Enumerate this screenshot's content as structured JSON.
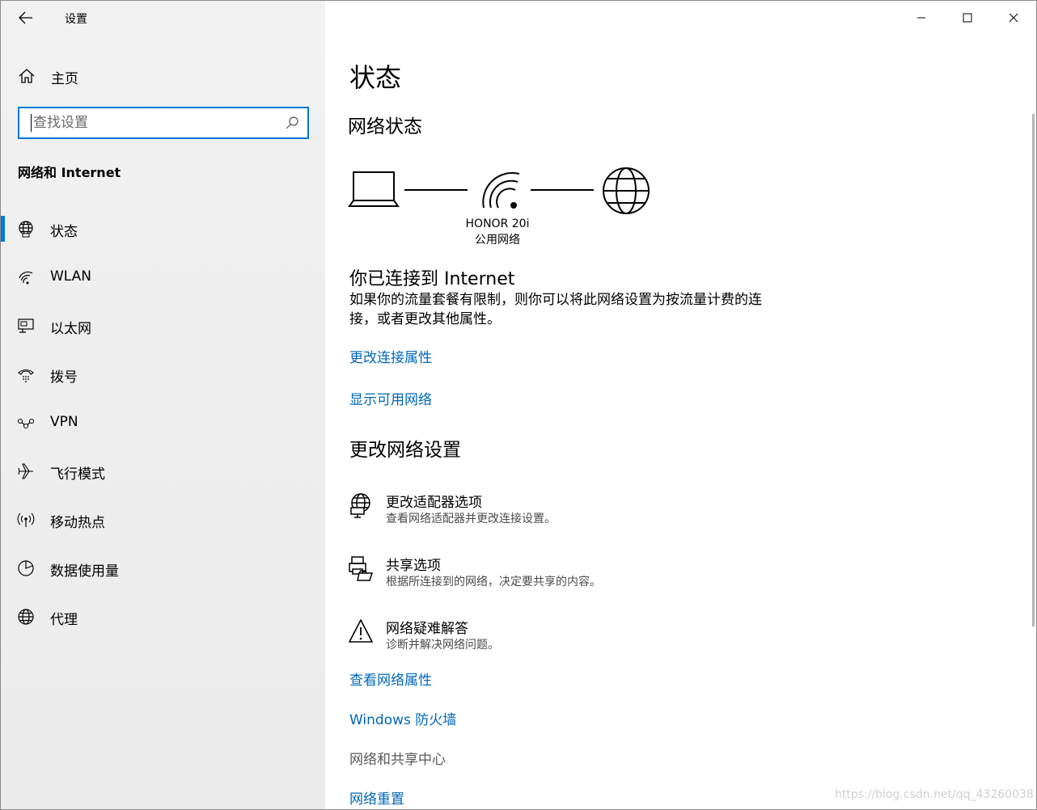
{
  "app": {
    "title": "设置"
  },
  "sidebar": {
    "home_label": "主页",
    "search_placeholder": "查找设置",
    "section_label": "网络和 Internet",
    "items": [
      {
        "label": "状态",
        "icon": "globe-status-icon",
        "active": true
      },
      {
        "label": "WLAN",
        "icon": "wifi-icon"
      },
      {
        "label": "以太网",
        "icon": "ethernet-icon"
      },
      {
        "label": "拨号",
        "icon": "dialup-icon"
      },
      {
        "label": "VPN",
        "icon": "vpn-icon"
      },
      {
        "label": "飞行模式",
        "icon": "airplane-icon"
      },
      {
        "label": "移动热点",
        "icon": "hotspot-icon"
      },
      {
        "label": "数据使用量",
        "icon": "data-usage-icon"
      },
      {
        "label": "代理",
        "icon": "proxy-globe-icon"
      }
    ]
  },
  "main": {
    "page_title": "状态",
    "network_status_title": "网络状态",
    "network": {
      "name": "HONOR 20i",
      "type": "公用网络"
    },
    "connected_title": "你已连接到 Internet",
    "connected_desc": "如果你的流量套餐有限制，则你可以将此网络设置为按流量计费的连接，或者更改其他属性。",
    "link_change_props": "更改连接属性",
    "link_show_networks": "显示可用网络",
    "change_settings_title": "更改网络设置",
    "options": [
      {
        "title": "更改适配器选项",
        "desc": "查看网络适配器并更改连接设置。",
        "icon": "adapter-icon"
      },
      {
        "title": "共享选项",
        "desc": "根据所连接到的网络，决定要共享的内容。",
        "icon": "sharing-icon"
      },
      {
        "title": "网络疑难解答",
        "desc": "诊断并解决网络问题。",
        "icon": "warning-icon"
      }
    ],
    "links_bottom": [
      {
        "label": "查看网络属性",
        "gray": false
      },
      {
        "label": "Windows 防火墙",
        "gray": false
      },
      {
        "label": "网络和共享中心",
        "gray": true
      },
      {
        "label": "网络重置",
        "gray": false
      }
    ]
  },
  "watermark": "https://blog.csdn.net/qq_43260038",
  "colors": {
    "accent": "#0078d7",
    "link": "#0067b8",
    "sidebar_bg": "#eeeeee"
  }
}
